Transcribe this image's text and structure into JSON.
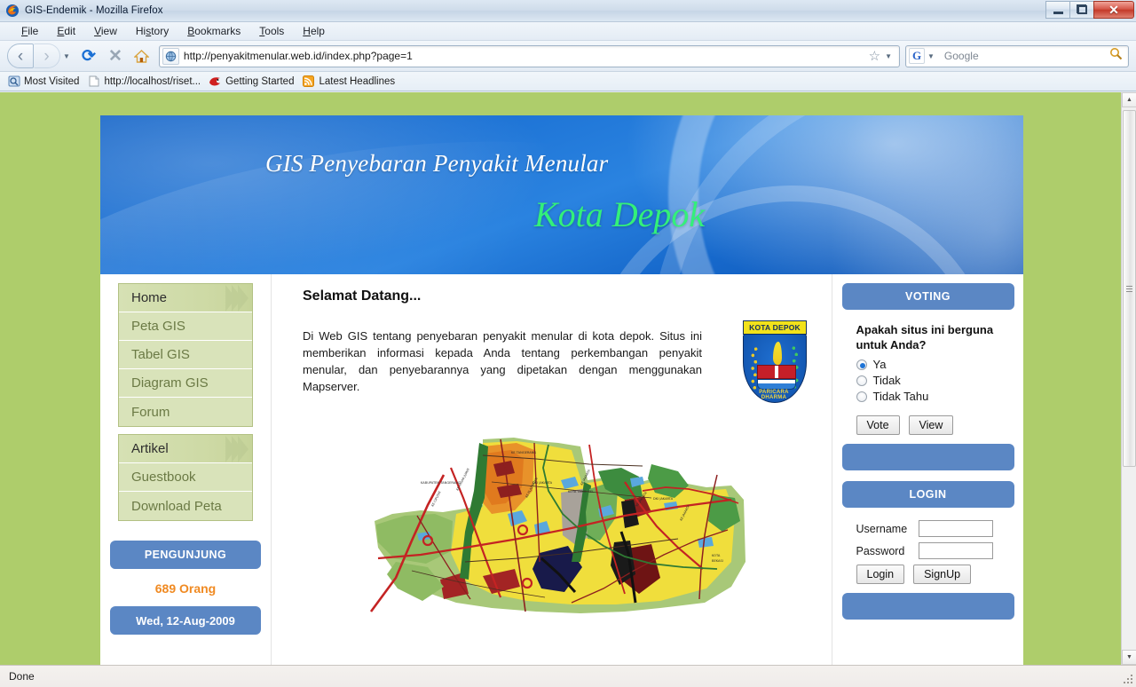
{
  "browser": {
    "window_title": "GIS-Endemik - Mozilla Firefox",
    "app_icon": "firefox-icon",
    "window_controls": {
      "minimize": "minimize-icon",
      "maximize": "maximize-icon",
      "close": "close-icon"
    },
    "menu": [
      {
        "label": "File",
        "accel": "F"
      },
      {
        "label": "Edit",
        "accel": "E"
      },
      {
        "label": "View",
        "accel": "V"
      },
      {
        "label": "History",
        "accel": "s"
      },
      {
        "label": "Bookmarks",
        "accel": "B"
      },
      {
        "label": "Tools",
        "accel": "T"
      },
      {
        "label": "Help",
        "accel": "H"
      }
    ],
    "toolbar": {
      "back": "back-icon",
      "forward": "forward-icon",
      "reload": "reload-icon",
      "stop": "stop-icon",
      "home": "home-icon",
      "url": "http://penyakitmenular.web.id/index.php?page=1",
      "bookmark_star": "star-icon",
      "search_engine": "G",
      "search_placeholder": "Google",
      "search_value": "",
      "search_icon": "magnifier-icon"
    },
    "bookmarks": [
      {
        "label": "Most Visited",
        "icon": "most-visited-icon"
      },
      {
        "label": "http://localhost/riset...",
        "icon": "page-icon"
      },
      {
        "label": "Getting Started",
        "icon": "firefox-head-icon"
      },
      {
        "label": "Latest Headlines",
        "icon": "rss-icon"
      }
    ],
    "status": "Done"
  },
  "site": {
    "banner": {
      "title": "GIS Penyebaran Penyakit Menular",
      "subtitle": "Kota Depok"
    },
    "left_nav": {
      "group1": [
        {
          "label": "Home",
          "active": true
        },
        {
          "label": "Peta GIS",
          "active": false
        },
        {
          "label": "Tabel GIS",
          "active": false
        },
        {
          "label": "Diagram GIS",
          "active": false
        },
        {
          "label": "Forum",
          "active": false
        }
      ],
      "group2": [
        {
          "label": "Artikel",
          "active": true
        },
        {
          "label": "Guestbook",
          "active": false
        },
        {
          "label": "Download Peta",
          "active": false
        }
      ]
    },
    "visitors": {
      "header": "PENGUNJUNG",
      "count": "689 Orang",
      "date": "Wed, 12-Aug-2009"
    },
    "content": {
      "heading": "Selamat Datang...",
      "paragraph": "Di Web GIS tentang penyebaran penyakit menular di kota depok. Situs ini memberikan informasi kepada Anda tentang perkembangan penyakit menular, dan penyebarannya yang dipetakan dengan menggunakan Mapserver.",
      "emblem": {
        "name": "kota-depok-emblem",
        "ribbon_text": "KOTA DEPOK",
        "motto": "PARICARA DHARMA"
      },
      "map_alt": "peta-kota-depok"
    },
    "voting": {
      "header": "VOTING",
      "question": "Apakah situs ini berguna untuk Anda?",
      "options": [
        {
          "label": "Ya",
          "selected": true
        },
        {
          "label": "Tidak",
          "selected": false
        },
        {
          "label": "Tidak Tahu",
          "selected": false
        }
      ],
      "vote_button": "Vote",
      "view_button": "View"
    },
    "login": {
      "header": "LOGIN",
      "username_label": "Username",
      "username_value": "",
      "password_label": "Password",
      "password_value": "",
      "login_button": "Login",
      "signup_button": "SignUp"
    },
    "colors": {
      "page_background": "#aecd6b",
      "panel_blue": "#5b87c4",
      "nav_green": "#d9e3ba",
      "accent_orange": "#f08a22",
      "banner_green_text": "#33f07a"
    }
  }
}
